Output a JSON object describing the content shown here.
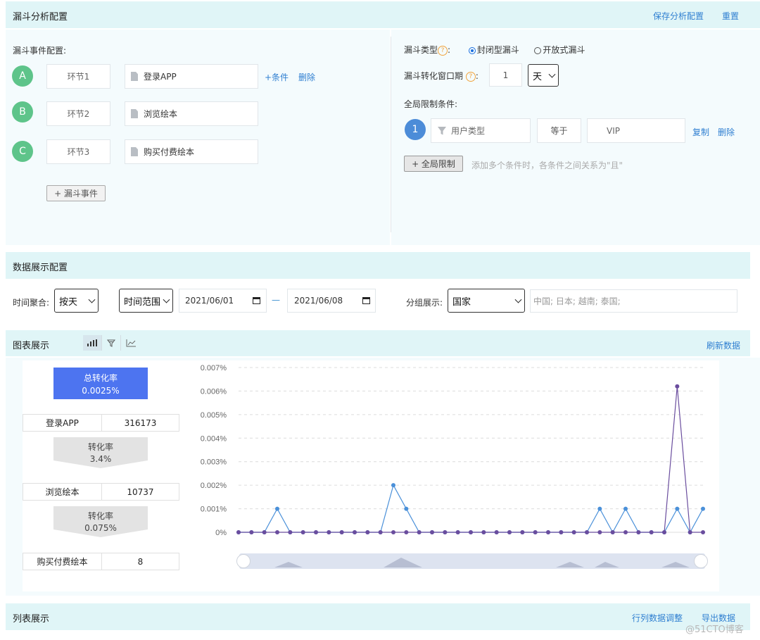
{
  "header": {
    "title": "漏斗分析配置",
    "save_label": "保存分析配置",
    "reset_label": "重置"
  },
  "funnel_events": {
    "title": "漏斗事件配置:",
    "steps": [
      {
        "letter": "A",
        "step": "环节1",
        "event": "登录APP"
      },
      {
        "letter": "B",
        "step": "环节2",
        "event": "浏览绘本"
      },
      {
        "letter": "C",
        "step": "环节3",
        "event": "购买付费绘本"
      }
    ],
    "add_condition": "+条件",
    "delete": "删除",
    "add_event": "+ 漏斗事件"
  },
  "funnel_settings": {
    "type_label": "漏斗类型",
    "type_options": [
      "封闭型漏斗",
      "开放式漏斗"
    ],
    "type_selected": "封闭型漏斗",
    "window_label": "漏斗转化窗口期",
    "window_value": "1",
    "window_unit": "天",
    "global_title": "全局限制条件:",
    "condition": {
      "index": "1",
      "field": "用户类型",
      "op": "等于",
      "value": "VIP"
    },
    "copy": "复制",
    "delete": "删除",
    "add_global": "+ 全局限制",
    "hint": "添加多个条件时，各条件之间关系为\"且\""
  },
  "display_config": {
    "title": "数据展示配置",
    "agg_label": "时间聚合:",
    "agg_value": "按天",
    "range_value": "时间范围",
    "start_date": "2021/06/01",
    "end_date": "2021/06/08",
    "dash": "—",
    "group_label": "分组展示:",
    "group_value": "国家",
    "group_tags": "中国; 日本; 越南; 泰国;"
  },
  "chart_section": {
    "title": "图表展示",
    "refresh": "刷新数据"
  },
  "funnel_summary": {
    "total_label": "总转化率",
    "total_value": "0.0025%",
    "steps": [
      {
        "name": "登录APP",
        "count": "316173"
      },
      {
        "name": "浏览绘本",
        "count": "10737"
      },
      {
        "name": "购买付费绘本",
        "count": "8"
      }
    ],
    "rates": [
      {
        "label": "转化率",
        "value": "3.4%"
      },
      {
        "label": "转化率",
        "value": "0.075%"
      }
    ]
  },
  "chart_data": {
    "type": "line",
    "y_ticks": [
      "0.007%",
      "0.006%",
      "0.005%",
      "0.004%",
      "0.003%",
      "0.002%",
      "0.001%",
      "0%"
    ],
    "ylim": [
      0,
      0.007
    ],
    "grid": true,
    "series": [
      {
        "color": "#4a90d9",
        "values": [
          0,
          0,
          0,
          0.001,
          0,
          0,
          0,
          0,
          0,
          0,
          0,
          0,
          0.002,
          0.001,
          0,
          0,
          0,
          0,
          0,
          0,
          0,
          0,
          0,
          0,
          0,
          0,
          0,
          0,
          0.001,
          0,
          0.001,
          0,
          0,
          0,
          0.001,
          0,
          0.001
        ]
      },
      {
        "color": "#6a4d9e",
        "values": [
          0,
          0,
          0,
          0,
          0,
          0,
          0,
          0,
          0,
          0,
          0,
          0,
          0,
          0,
          0,
          0,
          0,
          0,
          0,
          0,
          0,
          0,
          0,
          0,
          0,
          0,
          0,
          0,
          0,
          0,
          0,
          0,
          0,
          0,
          0.0062,
          0,
          0
        ]
      }
    ]
  },
  "list_section": {
    "title": "列表展示",
    "adjust": "行列数据调整",
    "export": "导出数据"
  },
  "watermark": "@51CTO博客"
}
